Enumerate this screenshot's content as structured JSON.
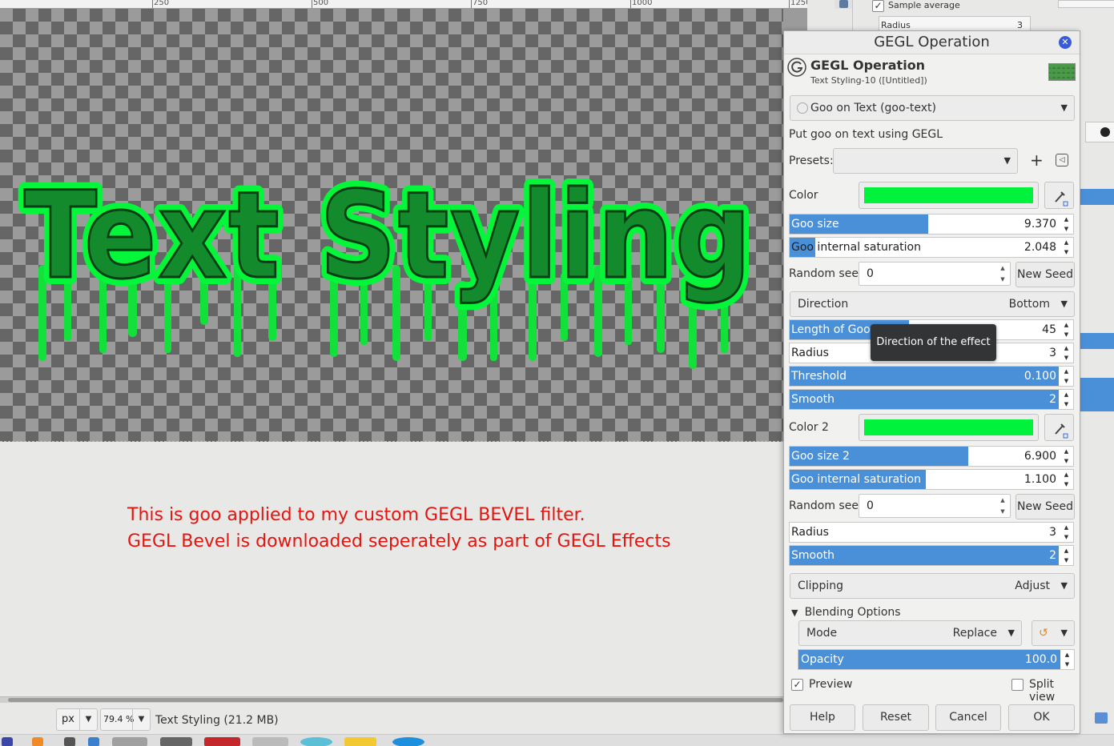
{
  "ruler": {
    "ticks": [
      "250",
      "500",
      "750",
      "1000",
      "1250"
    ]
  },
  "canvas": {
    "artwork_text": "Text Styling",
    "caption_line1": "This is goo applied to my custom GEGL BEVEL filter.",
    "caption_line2": "GEGL Bevel is downloaded seperately as part of GEGL Effects"
  },
  "status": {
    "unit": "px",
    "zoom": "79.4 %",
    "title": "Text Styling (21.2 MB)"
  },
  "right_panel": {
    "sample_average": "Sample average",
    "radius_label": "Radius",
    "radius_value": "3"
  },
  "dialog": {
    "title": "GEGL Operation",
    "header_title": "GEGL Operation",
    "header_subtitle": "Text Styling-10 ([Untitled])",
    "operation": "Goo on Text (goo-text)",
    "description": "Put goo on text using GEGL",
    "presets_label": "Presets:",
    "color_label": "Color",
    "goo_size_label": "Goo size",
    "goo_size_value": "9.370",
    "goo_sat_label": "Goo internal saturation",
    "goo_sat_value": "2.048",
    "seed_label": "Random seed",
    "seed_value": "0",
    "new_seed": "New Seed",
    "direction_label": "Direction",
    "direction_value": "Bottom",
    "length_label": "Length of Goo trail",
    "length_value": "45",
    "radius_label": "Radius",
    "radius_value": "3",
    "threshold_label": "Threshold",
    "threshold_value": "0.100",
    "smooth_label": "Smooth",
    "smooth_value": "2",
    "color2_label": "Color 2",
    "goo_size2_label": "Goo size 2",
    "goo_size2_value": "6.900",
    "goo_sat2_label": "Goo internal saturation",
    "goo_sat2_value": "1.100",
    "seed2_label": "Random seed",
    "seed2_value": "0",
    "new_seed2": "New Seed",
    "radius2_label": "Radius",
    "radius2_value": "3",
    "smooth2_label": "Smooth",
    "smooth2_value": "2",
    "clipping_label": "Clipping",
    "clipping_value": "Adjust",
    "blending_label": "Blending Options",
    "mode_label": "Mode",
    "mode_value": "Replace",
    "opacity_label": "Opacity",
    "opacity_value": "100.0",
    "preview_label": "Preview",
    "split_label": "Split view",
    "help": "Help",
    "reset": "Reset",
    "cancel": "Cancel",
    "ok": "OK",
    "tooltip": "Direction of the effect"
  },
  "colors": {
    "accent": "#4a90d9",
    "goo_green": "#00f23c",
    "caption_red": "#e4140f"
  }
}
